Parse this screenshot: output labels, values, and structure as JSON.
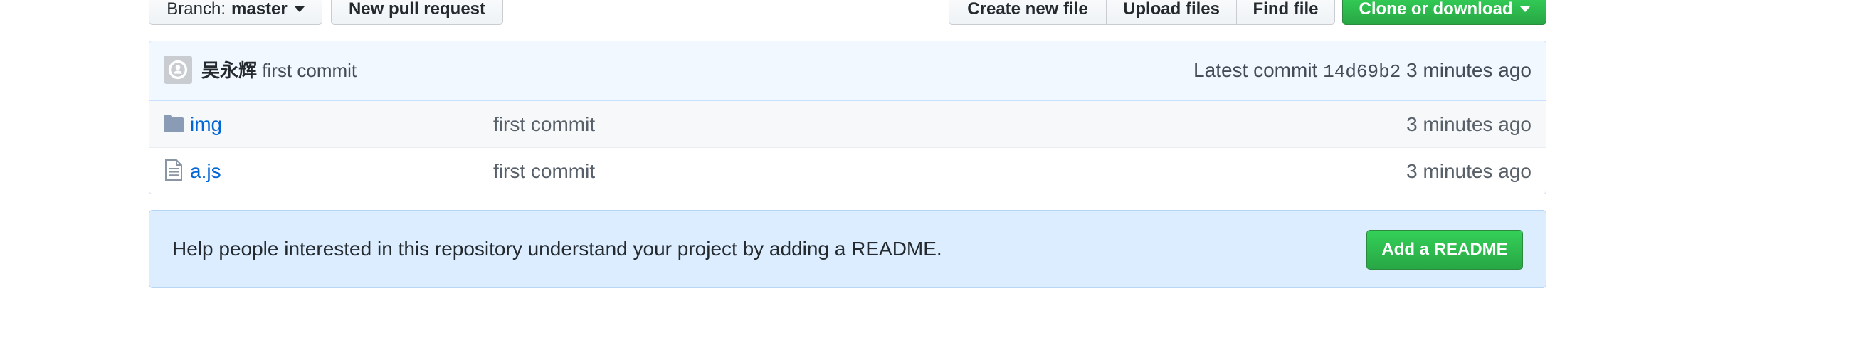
{
  "toolbar": {
    "branch_prefix": "Branch:",
    "branch_name": "master",
    "new_pull_request": "New pull request",
    "create_new_file": "Create new file",
    "upload_files": "Upload files",
    "find_file": "Find file",
    "clone_or_download": "Clone or download"
  },
  "commit_bar": {
    "author": "吴永辉",
    "message": "first commit",
    "latest_label": "Latest commit",
    "sha": "14d69b2",
    "time": "3 minutes ago"
  },
  "files": [
    {
      "name": "img",
      "type": "folder",
      "icon": "folder-icon",
      "message": "first commit",
      "age": "3 minutes ago"
    },
    {
      "name": "a.js",
      "type": "file",
      "icon": "file-icon",
      "message": "first commit",
      "age": "3 minutes ago"
    }
  ],
  "readme": {
    "text": "Help people interested in this repository understand your project by adding a README.",
    "button": "Add a README"
  },
  "colors": {
    "link": "#0366d6",
    "green": "#28a745",
    "banner": "#dbedff",
    "commit_bar": "#f1f8ff"
  }
}
